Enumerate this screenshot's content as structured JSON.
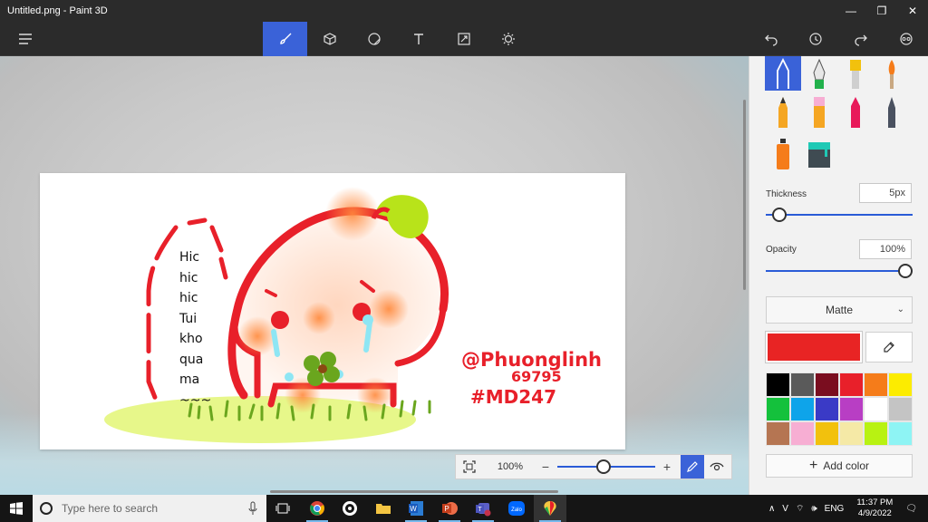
{
  "window": {
    "title": "Untitled.png - Paint 3D"
  },
  "toolbar": {
    "menu_icon": "hamburger-icon",
    "tools": [
      "brushes",
      "3d-shapes",
      "stickers",
      "text",
      "canvas",
      "effects"
    ]
  },
  "canvas": {
    "speech_lines": [
      "Hic",
      "hic",
      "hic",
      "Tui",
      "kho",
      "qua",
      "ma",
      "~~~"
    ],
    "signature": [
      "@Phuonglinh",
      "69795",
      "#MD247"
    ]
  },
  "zoom": {
    "value": "100%",
    "level_fraction": 0.47
  },
  "panel": {
    "thickness_label": "Thickness",
    "thickness_value": "5px",
    "thickness_fraction": 0.05,
    "opacity_label": "Opacity",
    "opacity_value": "100%",
    "opacity_fraction": 1.0,
    "finish": "Matte",
    "current_color": "#e82424",
    "palette": [
      "#000000",
      "#5a5a5a",
      "#7a0d1f",
      "#e8202a",
      "#f57c1a",
      "#fcec00",
      "#14c13c",
      "#0ea4ea",
      "#3a3ac6",
      "#b83ec4",
      "#ffffff",
      "#c4c4c4",
      "#b57552",
      "#f7aed3",
      "#f2c10d",
      "#f5e9a6",
      "#b8f212",
      "#8ef4f4"
    ],
    "add_color_label": "Add color"
  },
  "taskbar": {
    "search_placeholder": "Type here to search",
    "language": "ENG",
    "time": "11:37 PM",
    "date": "4/9/2022"
  }
}
